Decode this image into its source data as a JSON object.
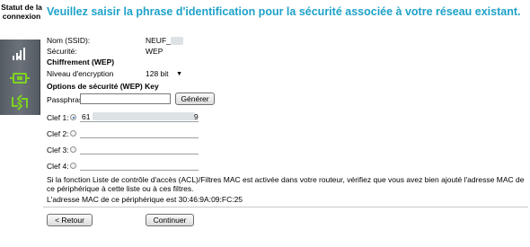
{
  "sidebar": {
    "status_label": "Statut de la connexion",
    "icons": [
      "wifi-signal-icon",
      "router-status-icon",
      "ethernet-connection-icon"
    ]
  },
  "heading": "Veuillez saisir la phrase d'identification pour la sécurité associée à votre réseau existant.",
  "network": {
    "ssid_label": "Nom (SSID):",
    "ssid_value": "NEUF_",
    "security_label": "Sécurité:",
    "security_value": "WEP"
  },
  "wep": {
    "section_title": "Chiffrement (WEP)",
    "encryption_label": "Niveau d'encryption",
    "encryption_value": "128 bit",
    "options_title": "Options de sécurité (WEP) Key",
    "passphrase_label": "Passphrase:",
    "passphrase_value": "",
    "generate_label": "Générer",
    "keys": [
      {
        "label": "Clef 1:",
        "value": "61",
        "value_end": "9",
        "selected": true
      },
      {
        "label": "Clef 2:",
        "value": "",
        "selected": false
      },
      {
        "label": "Clef 3:",
        "value": "",
        "selected": false
      },
      {
        "label": "Clef 4:",
        "value": "",
        "selected": false
      }
    ]
  },
  "notice": {
    "line1": "Si la fonction Liste de contrôle d'accès (ACL)/Filtres MAC est activée dans votre routeur, vérifiez que vous avez bien ajouté l'adresse MAC de",
    "line2": "ce périphérique à cette liste ou à ces filtres.",
    "mac_line": "L'adresse MAC de ce périphérique est 30:46:9A:09:FC:25"
  },
  "buttons": {
    "back_label": "< Retour",
    "continue_label": "Continuer"
  },
  "colors": {
    "heading": "#1da2c9",
    "sidebar_bg": "#60676e",
    "icon_green": "#7ed321"
  }
}
